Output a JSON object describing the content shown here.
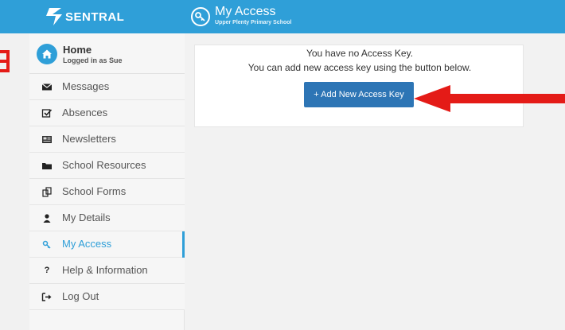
{
  "brand": {
    "name": "SENTRAL"
  },
  "header": {
    "title": "My Access",
    "subtitle": "Upper Plenty Primary School"
  },
  "sidebar": {
    "home": {
      "title": "Home",
      "subtitle": "Logged in as Sue"
    },
    "items": [
      {
        "label": "Messages",
        "icon": "envelope-icon"
      },
      {
        "label": "Absences",
        "icon": "checkbox-icon"
      },
      {
        "label": "Newsletters",
        "icon": "newspaper-icon"
      },
      {
        "label": "School Resources",
        "icon": "folder-icon"
      },
      {
        "label": "School Forms",
        "icon": "copy-icon"
      },
      {
        "label": "My Details",
        "icon": "user-icon"
      },
      {
        "label": "My Access",
        "icon": "key-icon",
        "active": true
      },
      {
        "label": "Help & Information",
        "icon": "question-icon"
      },
      {
        "label": "Log Out",
        "icon": "logout-icon"
      }
    ]
  },
  "main": {
    "message_line1": "You have no Access Key.",
    "message_line2": "You can add new access key using the button below.",
    "add_button": "+ Add New Access Key"
  },
  "colors": {
    "accent": "#2f9fd8",
    "button": "#2d75b5",
    "annotation": "#e41b17"
  }
}
